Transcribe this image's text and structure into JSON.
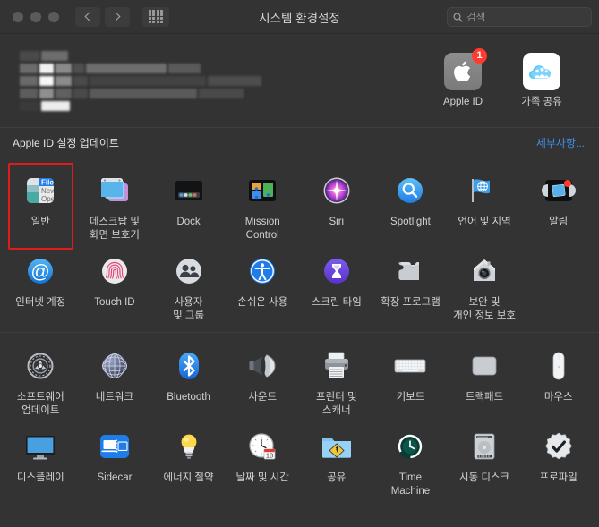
{
  "window": {
    "title": "시스템 환경설정",
    "traffic_lights": [
      "close",
      "minimize",
      "zoom"
    ],
    "nav_back": "back-button",
    "nav_forward": "forward-button",
    "show_all": "show-all-grid-button"
  },
  "search": {
    "placeholder": "검색",
    "value": ""
  },
  "account": {
    "user_name_blurred": true,
    "tiles": [
      {
        "label": "Apple ID",
        "icon": "apple-logo-icon",
        "badge": "1"
      },
      {
        "label": "가족\n공유",
        "icon": "family-sharing-icon",
        "badge": ""
      }
    ]
  },
  "banner": {
    "text": "Apple ID 설정 업데이트",
    "link": "세부사항..."
  },
  "colors": {
    "window_bg": "#333333",
    "titlebar_bg": "#333333",
    "label": "#d2d2d2",
    "link_blue": "#3f8fe8",
    "badge_red": "#ff3b30",
    "selection_red": "#e01b1b",
    "divider": "#3e3e3e"
  },
  "sections": [
    {
      "name": "personal",
      "items": [
        {
          "label": "일반",
          "icon": "general-menu-icon",
          "selected": true
        },
        {
          "label": "데스크탑 및\n화면 보호기",
          "icon": "desktop-screensaver-icon",
          "selected": false
        },
        {
          "label": "Dock",
          "icon": "dock-icon",
          "selected": false
        },
        {
          "label": "Mission\nControl",
          "icon": "mission-control-icon",
          "selected": false
        },
        {
          "label": "Siri",
          "icon": "siri-icon",
          "selected": false
        },
        {
          "label": "Spotlight",
          "icon": "spotlight-icon",
          "selected": false
        },
        {
          "label": "언어 및 지역",
          "icon": "language-region-flag-icon",
          "selected": false
        },
        {
          "label": "알림",
          "icon": "notifications-icon",
          "selected": false
        },
        {
          "label": "인터넷 계정",
          "icon": "internet-accounts-at-icon",
          "selected": false
        },
        {
          "label": "Touch ID",
          "icon": "touch-id-fingerprint-icon",
          "selected": false
        },
        {
          "label": "사용자\n및 그룹",
          "icon": "users-groups-icon",
          "selected": false
        },
        {
          "label": "손쉬운 사용",
          "icon": "accessibility-icon",
          "selected": false
        },
        {
          "label": "스크린 타임",
          "icon": "screen-time-hourglass-icon",
          "selected": false
        },
        {
          "label": "확장 프로그램",
          "icon": "extensions-puzzle-icon",
          "selected": false
        },
        {
          "label": "보안 및\n개인 정보 보호",
          "icon": "security-privacy-house-icon",
          "selected": false
        }
      ]
    },
    {
      "name": "hardware",
      "items": [
        {
          "label": "소프트웨어\n업데이트",
          "icon": "software-update-gear-icon",
          "selected": false
        },
        {
          "label": "네트워크",
          "icon": "network-globe-icon",
          "selected": false
        },
        {
          "label": "Bluetooth",
          "icon": "bluetooth-icon",
          "selected": false
        },
        {
          "label": "사운드",
          "icon": "sound-speaker-icon",
          "selected": false
        },
        {
          "label": "프린터 및\n스캐너",
          "icon": "printer-scanner-icon",
          "selected": false
        },
        {
          "label": "키보드",
          "icon": "keyboard-icon",
          "selected": false
        },
        {
          "label": "트랙패드",
          "icon": "trackpad-icon",
          "selected": false
        },
        {
          "label": "마우스",
          "icon": "mouse-icon",
          "selected": false
        },
        {
          "label": "디스플레이",
          "icon": "display-monitor-icon",
          "selected": false
        },
        {
          "label": "Sidecar",
          "icon": "sidecar-icon",
          "selected": false
        },
        {
          "label": "에너지 절약",
          "icon": "energy-saver-bulb-icon",
          "selected": false
        },
        {
          "label": "날짜 및 시간",
          "icon": "date-time-clock-icon",
          "selected": false
        },
        {
          "label": "공유",
          "icon": "sharing-folder-icon",
          "selected": false
        },
        {
          "label": "Time\nMachine",
          "icon": "time-machine-icon",
          "selected": false
        },
        {
          "label": "시동 디스크",
          "icon": "startup-disk-icon",
          "selected": false
        },
        {
          "label": "프로파일",
          "icon": "profiles-badge-icon",
          "selected": false
        }
      ]
    }
  ]
}
